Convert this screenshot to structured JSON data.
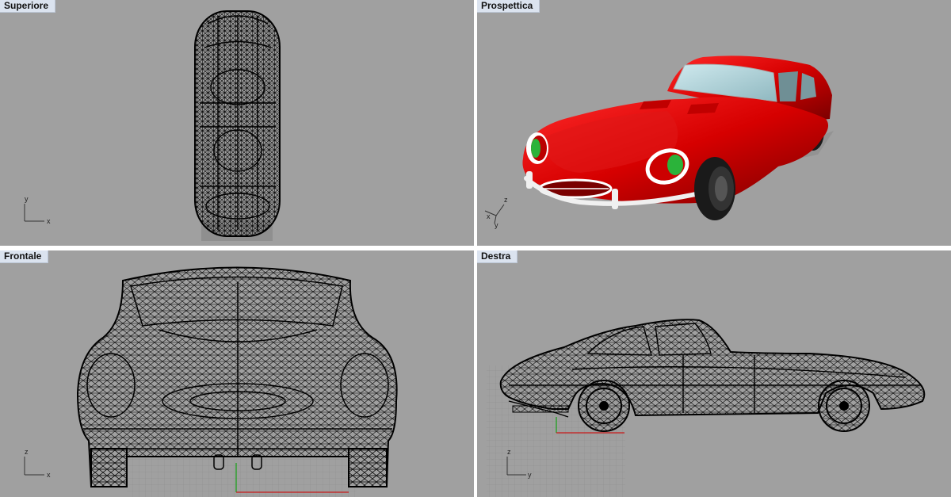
{
  "viewports": {
    "top": {
      "label": "Superiore"
    },
    "persp": {
      "label": "Prospettica"
    },
    "front": {
      "label": "Frontale"
    },
    "right": {
      "label": "Destra"
    }
  },
  "axes": {
    "top": {
      "v": "y",
      "h": "x"
    },
    "persp": {
      "v": "z",
      "h1": "x",
      "h2": "y"
    },
    "front": {
      "v": "z",
      "h": "x"
    },
    "right": {
      "v": "z",
      "h": "y"
    }
  },
  "colors": {
    "viewport_bg": "#a0a0a0",
    "label_bg": "#dbe3ef",
    "car_body": "#d40000",
    "wire": "#000000",
    "headlight": "#2bb33a"
  }
}
